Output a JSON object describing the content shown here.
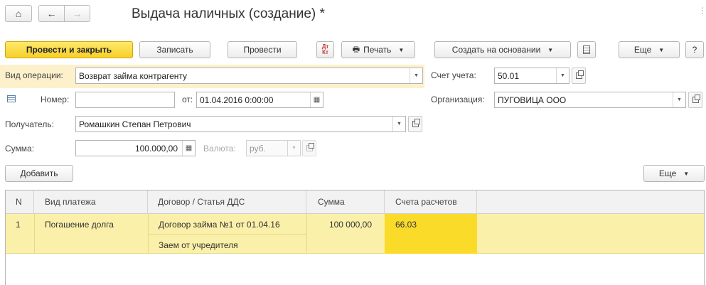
{
  "window": {
    "title": "Выдача наличных (создание) *"
  },
  "toolbar": {
    "post_close": "Провести и закрыть",
    "save": "Записать",
    "post": "Провести",
    "dt_kt": "Дт\nКт",
    "print": "Печать",
    "create_based": "Создать на основании",
    "more": "Еще",
    "help": "?"
  },
  "form": {
    "operation_label": "Вид операции:",
    "operation_value": "Возврат займа контрагенту",
    "account_label": "Счет учета:",
    "account_value": "50.01",
    "number_label": "Номер:",
    "number_value": "",
    "date_label": "от:",
    "date_value": "01.04.2016  0:00:00",
    "org_label": "Организация:",
    "org_value": "ПУГОВИЦА ООО",
    "recipient_label": "Получатель:",
    "recipient_value": "Ромашкин Степан Петрович",
    "sum_label": "Сумма:",
    "sum_value": "100.000,00",
    "currency_label": "Валюта:",
    "currency_value": "руб."
  },
  "table_toolbar": {
    "add": "Добавить",
    "more": "Еще"
  },
  "table": {
    "columns": [
      "N",
      "Вид платежа",
      "Договор / Статья ДДС",
      "Сумма",
      "Счета расчетов"
    ],
    "rows": [
      {
        "n": "1",
        "payment_type": "Погашение долга",
        "contract": "Договор займа №1 от 01.04.16",
        "dds_item": "Заем от учредителя",
        "sum": "100 000,00",
        "account": "66.03"
      }
    ]
  },
  "colors": {
    "accent_yellow": "#f5cf2a",
    "row_highlight": "#fbf0a9",
    "cell_highlight": "#fbdb2a"
  }
}
